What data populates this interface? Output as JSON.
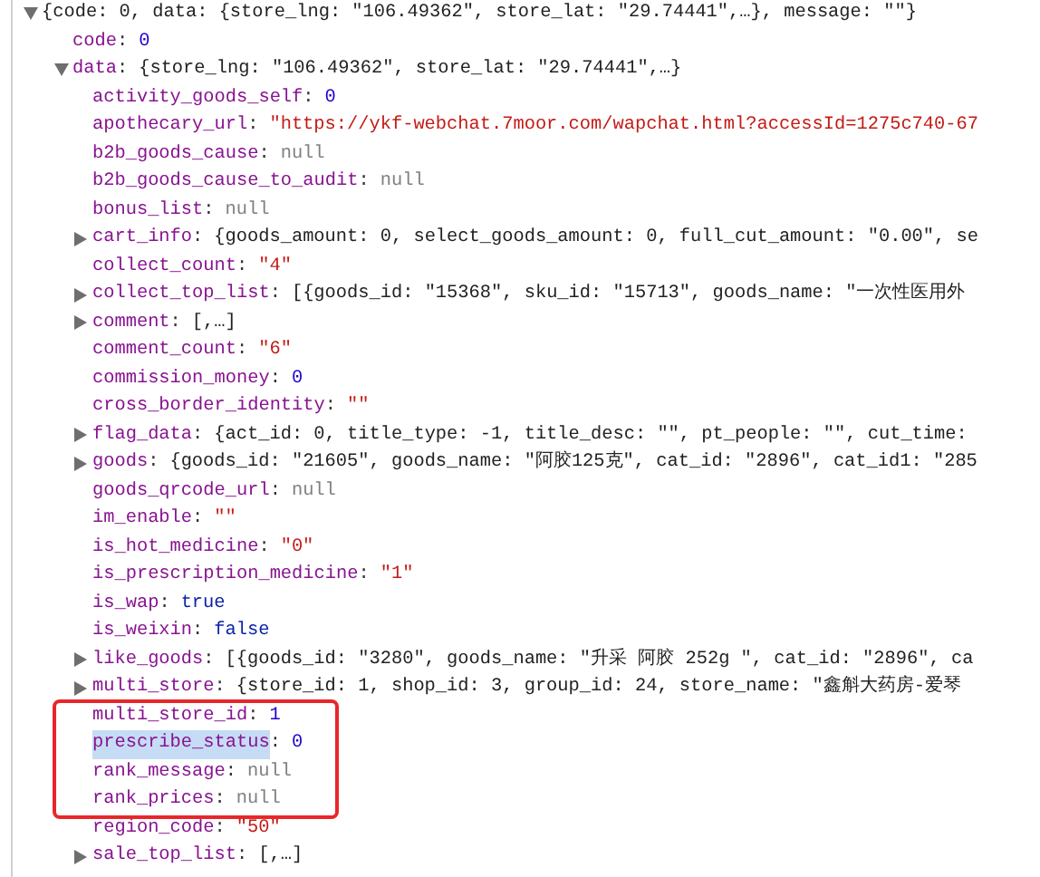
{
  "separator": ":",
  "tree": [
    {
      "value": "{code: 0, data: {store_lng: \"106.49362\", store_lat: \"29.74441\",…}, message: \"\"}",
      "kind": "preview",
      "expanded": true,
      "children": [
        {
          "key": "code",
          "value": "0",
          "kind": "number"
        },
        {
          "key": "data",
          "value": "{store_lng: \"106.49362\", store_lat: \"29.74441\",…}",
          "kind": "preview",
          "expanded": true,
          "children": [
            {
              "key": "activity_goods_self",
              "value": "0",
              "kind": "number"
            },
            {
              "key": "apothecary_url",
              "value": "\"https://ykf-webchat.7moor.com/wapchat.html?accessId=1275c740-67",
              "kind": "string"
            },
            {
              "key": "b2b_goods_cause",
              "value": "null",
              "kind": "null"
            },
            {
              "key": "b2b_goods_cause_to_audit",
              "value": "null",
              "kind": "null"
            },
            {
              "key": "bonus_list",
              "value": "null",
              "kind": "null"
            },
            {
              "key": "cart_info",
              "value": "{goods_amount: 0, select_goods_amount: 0, full_cut_amount: \"0.00\", se",
              "kind": "preview",
              "expanded": false
            },
            {
              "key": "collect_count",
              "value": "\"4\"",
              "kind": "string"
            },
            {
              "key": "collect_top_list",
              "value": "[{goods_id: \"15368\", sku_id: \"15713\", goods_name: \"一次性医用外",
              "kind": "preview",
              "expanded": false
            },
            {
              "key": "comment",
              "value": "[,…]",
              "kind": "preview",
              "expanded": false
            },
            {
              "key": "comment_count",
              "value": "\"6\"",
              "kind": "string"
            },
            {
              "key": "commission_money",
              "value": "0",
              "kind": "number"
            },
            {
              "key": "cross_border_identity",
              "value": "\"\"",
              "kind": "string"
            },
            {
              "key": "flag_data",
              "value": "{act_id: 0, title_type: -1, title_desc: \"\", pt_people: \"\", cut_time:",
              "kind": "preview",
              "expanded": false
            },
            {
              "key": "goods",
              "value": "{goods_id: \"21605\", goods_name: \"阿胶125克\", cat_id: \"2896\", cat_id1: \"285",
              "kind": "preview",
              "expanded": false
            },
            {
              "key": "goods_qrcode_url",
              "value": "null",
              "kind": "null"
            },
            {
              "key": "im_enable",
              "value": "\"\"",
              "kind": "string"
            },
            {
              "key": "is_hot_medicine",
              "value": "\"0\"",
              "kind": "string"
            },
            {
              "key": "is_prescription_medicine",
              "value": "\"1\"",
              "kind": "string"
            },
            {
              "key": "is_wap",
              "value": "true",
              "kind": "boolean"
            },
            {
              "key": "is_weixin",
              "value": "false",
              "kind": "boolean"
            },
            {
              "key": "like_goods",
              "value": "[{goods_id: \"3280\", goods_name: \"升采 阿胶 252g \", cat_id: \"2896\", ca",
              "kind": "preview",
              "expanded": false
            },
            {
              "key": "multi_store",
              "value": "{store_id: 1, shop_id: 3, group_id: 24, store_name: \"鑫斛大药房-爱琴",
              "kind": "preview",
              "expanded": false
            },
            {
              "key": "multi_store_id",
              "value": "1",
              "kind": "number",
              "boxed": true
            },
            {
              "key": "prescribe_status",
              "value": "0",
              "kind": "number",
              "boxed": true,
              "selected": true
            },
            {
              "key": "rank_message",
              "value": "null",
              "kind": "null",
              "boxed": true
            },
            {
              "key": "rank_prices",
              "value": "null",
              "kind": "null",
              "boxed": true
            },
            {
              "key": "region_code",
              "value": "\"50\"",
              "kind": "string"
            },
            {
              "key": "sale_top_list",
              "value": "[,…]",
              "kind": "preview",
              "expanded": false
            }
          ]
        }
      ]
    }
  ]
}
